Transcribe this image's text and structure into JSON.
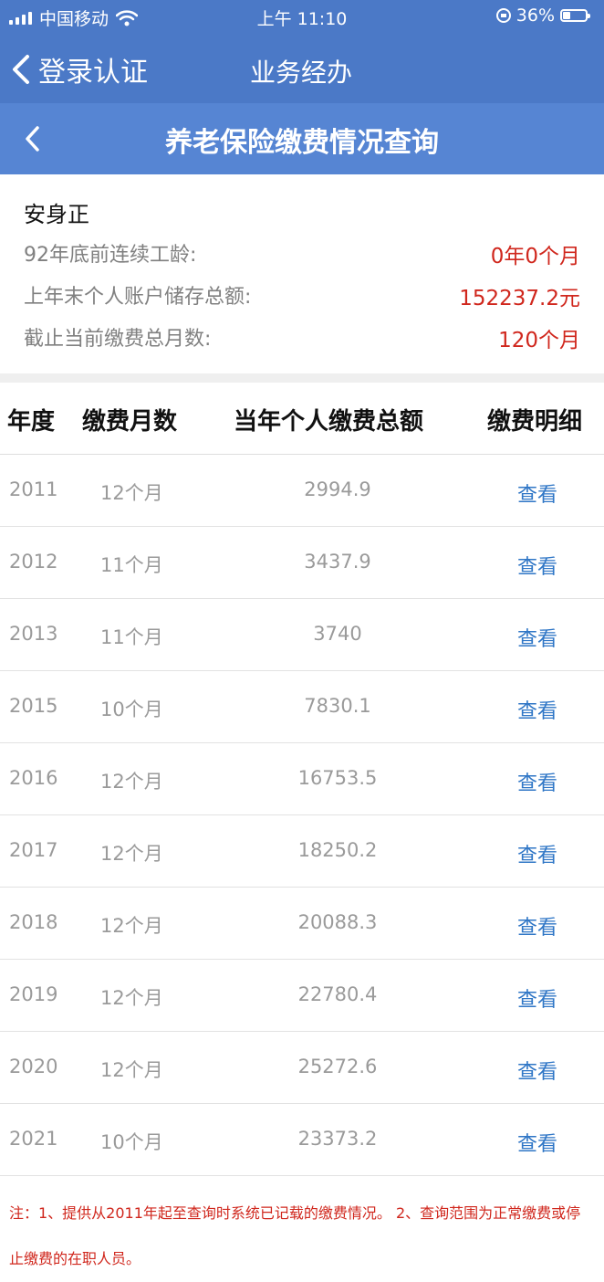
{
  "status_bar": {
    "carrier": "中国移动",
    "time": "上午 11:10",
    "battery": "36%"
  },
  "nav": {
    "back_label": "登录认证",
    "title": "业务经办"
  },
  "page": {
    "title": "养老保险缴费情况查询"
  },
  "person": {
    "name": "安身正",
    "fields": [
      {
        "label": "92年底前连续工龄:",
        "value": "0年0个月"
      },
      {
        "label": "上年末个人账户储存总额:",
        "value": "152237.2元"
      },
      {
        "label": "截止当前缴费总月数:",
        "value": "120个月"
      }
    ]
  },
  "table": {
    "headers": [
      "年度",
      "缴费月数",
      "当年个人缴费总额",
      "缴费明细"
    ],
    "rows": [
      {
        "year": "2011",
        "months": "12个月",
        "amount": "2994.9",
        "detail": "查看"
      },
      {
        "year": "2012",
        "months": "11个月",
        "amount": "3437.9",
        "detail": "查看"
      },
      {
        "year": "2013",
        "months": "11个月",
        "amount": "3740",
        "detail": "查看"
      },
      {
        "year": "2015",
        "months": "10个月",
        "amount": "7830.1",
        "detail": "查看"
      },
      {
        "year": "2016",
        "months": "12个月",
        "amount": "16753.5",
        "detail": "查看"
      },
      {
        "year": "2017",
        "months": "12个月",
        "amount": "18250.2",
        "detail": "查看"
      },
      {
        "year": "2018",
        "months": "12个月",
        "amount": "20088.3",
        "detail": "查看"
      },
      {
        "year": "2019",
        "months": "12个月",
        "amount": "22780.4",
        "detail": "查看"
      },
      {
        "year": "2020",
        "months": "12个月",
        "amount": "25272.6",
        "detail": "查看"
      },
      {
        "year": "2021",
        "months": "10个月",
        "amount": "23373.2",
        "detail": "查看"
      }
    ]
  },
  "note": "注：1、提供从2011年起至查询时系统已记载的缴费情况。 2、查询范围为正常缴费或停止缴费的在职人员。",
  "colors": {
    "nav_blue": "#4b79c7",
    "header_blue": "#5685d3",
    "accent_red": "#d0271d",
    "link_blue": "#2f76c6"
  }
}
